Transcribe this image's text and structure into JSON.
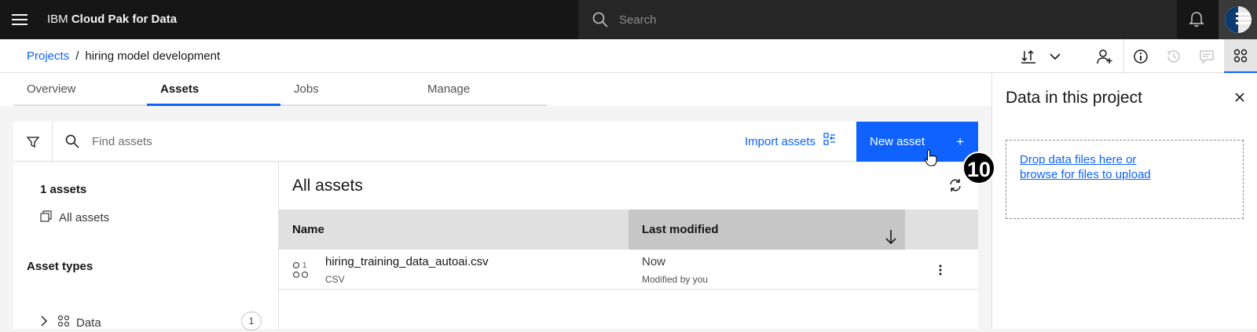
{
  "topbar": {
    "brand_prefix": "IBM",
    "brand_name": "Cloud Pak for Data",
    "search_placeholder": "Search"
  },
  "breadcrumb": {
    "root": "Projects",
    "separator": "/",
    "current": "hiring model development"
  },
  "tabs": [
    {
      "label": "Overview",
      "active": false
    },
    {
      "label": "Assets",
      "active": true
    },
    {
      "label": "Jobs",
      "active": false
    },
    {
      "label": "Manage",
      "active": false
    }
  ],
  "toolbar": {
    "find_placeholder": "Find assets",
    "import_label": "Import assets",
    "new_asset_label": "New asset",
    "new_asset_icon": "+"
  },
  "left_panel": {
    "count_label": "1 assets",
    "all_assets_label": "All assets",
    "asset_types_label": "Asset types",
    "types": [
      {
        "label": "Data",
        "count": "1"
      }
    ]
  },
  "content": {
    "title": "All assets",
    "columns": {
      "name": "Name",
      "last_modified": "Last modified"
    },
    "rows": [
      {
        "name": "hiring_training_data_autoai.csv",
        "type": "CSV",
        "modified": "Now",
        "modified_by": "Modified by you"
      }
    ]
  },
  "right_panel": {
    "title": "Data in this project",
    "drop_line1": "Drop data files here or",
    "drop_line2": "browse for files to upload"
  },
  "step_marker": "10",
  "colors": {
    "accent": "#0f62fe",
    "topbar": "#161616"
  }
}
